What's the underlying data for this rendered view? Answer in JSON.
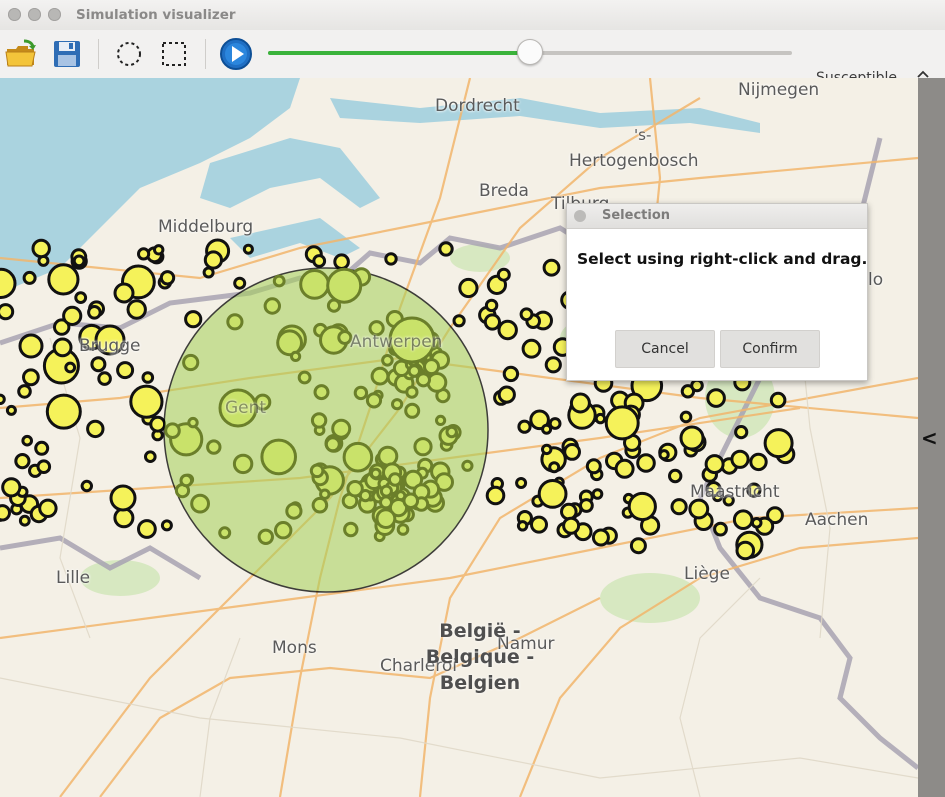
{
  "window": {
    "title": "Simulation visualizer"
  },
  "toolbar": {
    "open_icon": "open-folder-icon",
    "save_icon": "save-icon",
    "circle_select_icon": "circle-select-icon",
    "rect_select_icon": "rect-select-icon",
    "play_icon": "play-icon",
    "timeline_progress": 0.5,
    "state_select": {
      "selected": "Susceptible"
    }
  },
  "map": {
    "cities": {
      "dordrecht": "Dordrecht",
      "nijmegen": "Nijmegen",
      "hertogenbosch": "Hertogenbosch",
      "hertogenbosch_prefix": "'s-",
      "breda": "Breda",
      "tilburg": "Tilburg",
      "middelburg": "Middelburg",
      "brugge": "Brugge",
      "antwerpen": "Antwerpen",
      "gent": "Gent",
      "eindhoven_fragment": "lo",
      "maastricht": "Maastricht",
      "aachen": "Aachen",
      "lille": "Lille",
      "liege": "Liège",
      "mons": "Mons",
      "namur": "Namur",
      "charleroi": "Charleroi"
    },
    "country": [
      "België -",
      "Belgique -",
      "Belgien"
    ],
    "selection_circle_color": "#a6d05a",
    "node_color": "#f5f25a",
    "node_border": "#111111"
  },
  "dialog": {
    "title": "Selection",
    "message": "Select using right-click and drag.",
    "cancel_label": "Cancel",
    "confirm_label": "Confirm"
  },
  "side_panel": {
    "toggle_label": "<"
  }
}
